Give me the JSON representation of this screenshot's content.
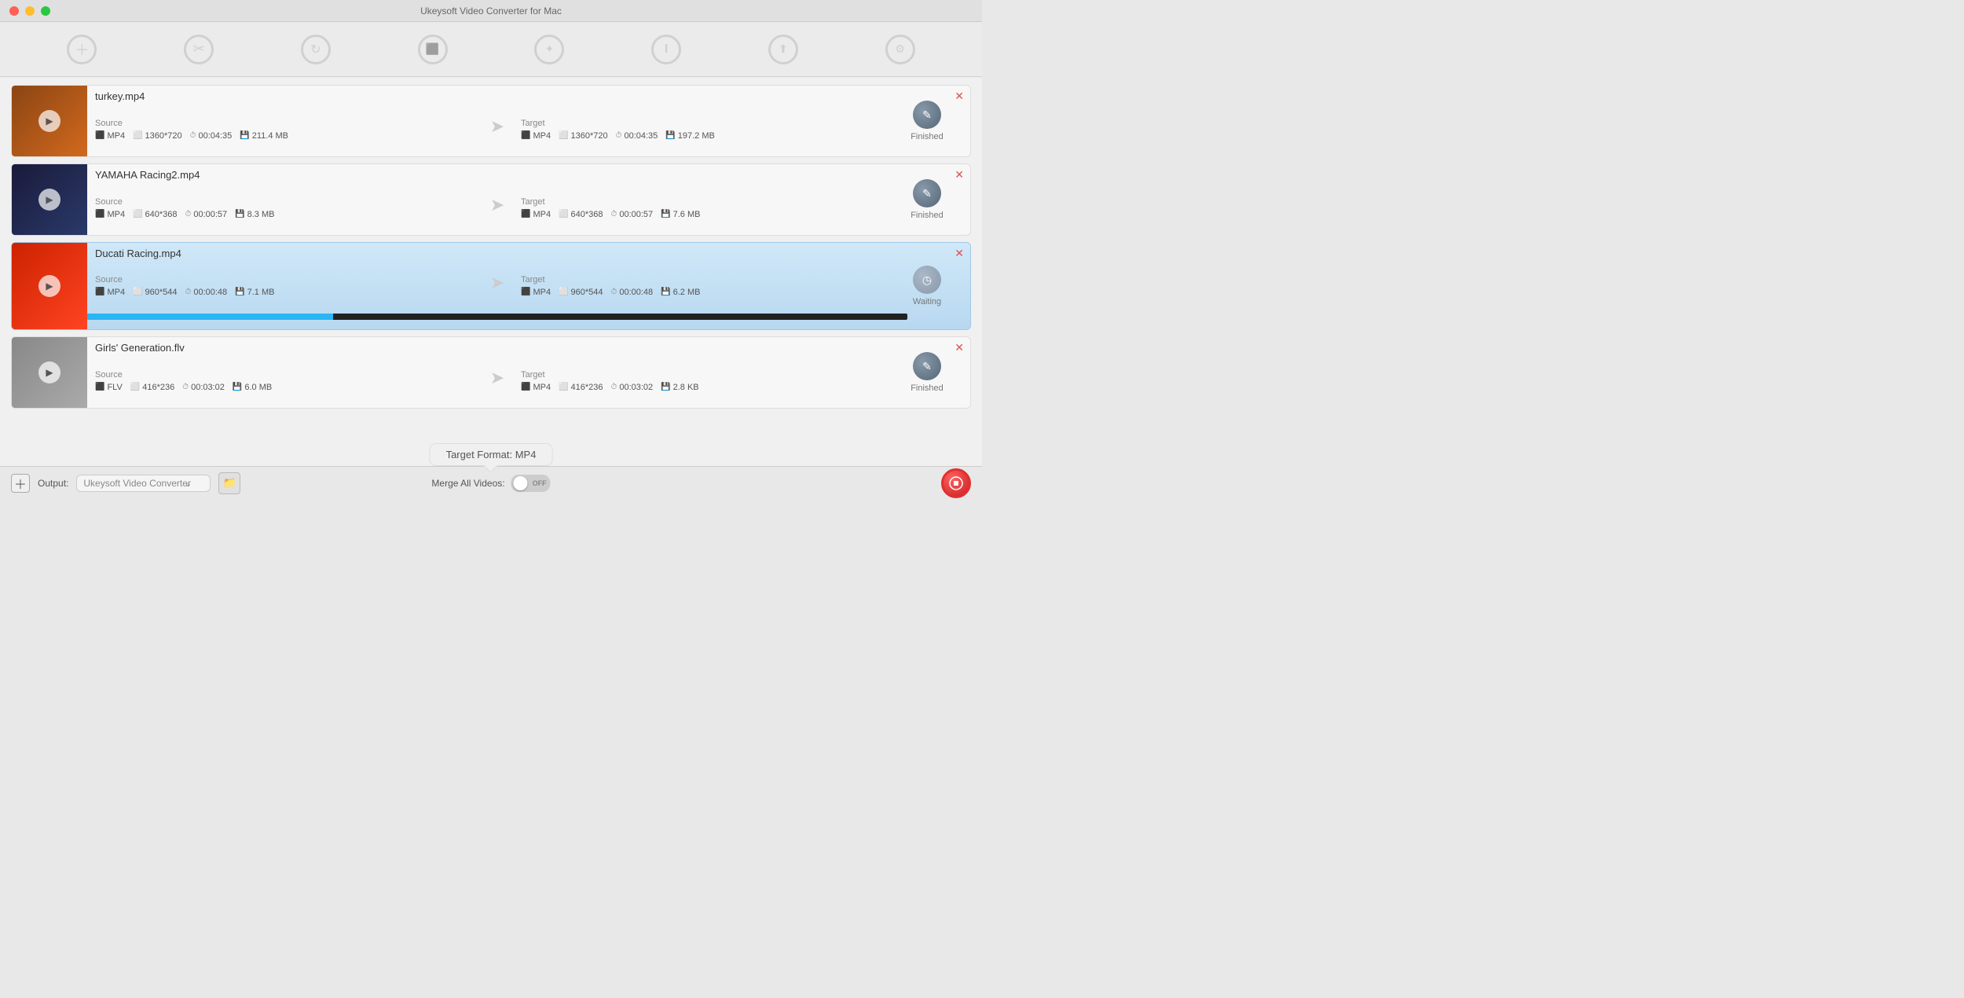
{
  "app": {
    "title": "Ukeysoft Video Converter for Mac"
  },
  "toolbar": {
    "items": [
      {
        "label": "Add",
        "icon": "+"
      },
      {
        "label": "Trim",
        "icon": "✂"
      },
      {
        "label": "Convert",
        "icon": "↻"
      },
      {
        "label": "Compress",
        "icon": "⬛"
      },
      {
        "label": "Effects",
        "icon": "✦"
      },
      {
        "label": "Text",
        "icon": "T"
      },
      {
        "label": "Export",
        "icon": "↑"
      },
      {
        "label": "Settings",
        "icon": "⚙"
      }
    ]
  },
  "videos": [
    {
      "filename": "turkey.mp4",
      "status": "Finished",
      "statusType": "finished",
      "thumbnailColor": "#8B4513",
      "thumbnailColor2": "#D2691E",
      "source": {
        "format": "MP4",
        "resolution": "1360*720",
        "duration": "00:04:35",
        "size": "211.4 MB"
      },
      "target": {
        "format": "MP4",
        "resolution": "1360*720",
        "duration": "00:04:35",
        "size": "197.2 MB"
      },
      "progress": null
    },
    {
      "filename": "YAMAHA Racing2.mp4",
      "status": "Finished",
      "statusType": "finished",
      "thumbnailColor": "#1a1a3a",
      "thumbnailColor2": "#2a3a6a",
      "source": {
        "format": "MP4",
        "resolution": "640*368",
        "duration": "00:00:57",
        "size": "8.3 MB"
      },
      "target": {
        "format": "MP4",
        "resolution": "640*368",
        "duration": "00:00:57",
        "size": "7.6 MB"
      },
      "progress": null
    },
    {
      "filename": "Ducati Racing.mp4",
      "status": "Waiting",
      "statusType": "waiting",
      "thumbnailColor": "#cc2200",
      "thumbnailColor2": "#ff4422",
      "source": {
        "format": "MP4",
        "resolution": "960*544",
        "duration": "00:00:48",
        "size": "7.1 MB"
      },
      "target": {
        "format": "MP4",
        "resolution": "960*544",
        "duration": "00:00:48",
        "size": "6.2 MB"
      },
      "progress": 30
    },
    {
      "filename": "Girls' Generation.flv",
      "status": "Finished",
      "statusType": "finished",
      "thumbnailColor": "#888888",
      "thumbnailColor2": "#aaaaaa",
      "source": {
        "format": "FLV",
        "resolution": "416*236",
        "duration": "00:03:02",
        "size": "6.0 MB"
      },
      "target": {
        "format": "MP4",
        "resolution": "416*236",
        "duration": "00:03:02",
        "size": "2.8 KB"
      },
      "progress": null
    }
  ],
  "bottom": {
    "add_label": "+",
    "output_label": "Output:",
    "output_value": "Ukeysoft Video Converter",
    "merge_label": "Merge All Videos:",
    "toggle_state": "OFF",
    "convert_icon": "⏹",
    "tooltip": "Target Format: MP4"
  }
}
